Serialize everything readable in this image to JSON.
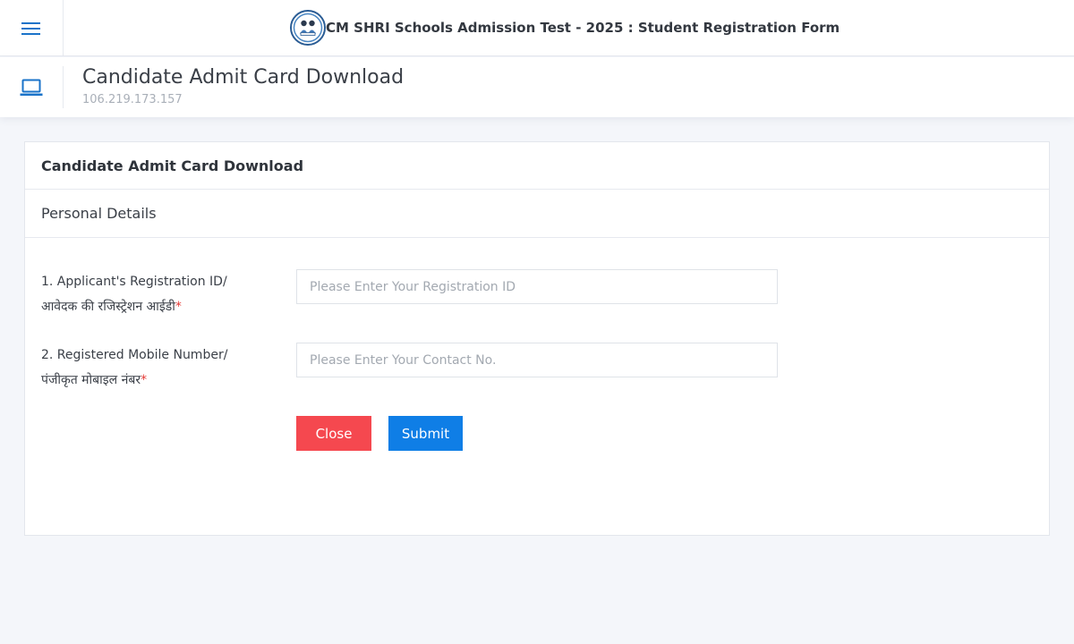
{
  "topbar": {
    "title": "CM SHRI Schools Admission Test - 2025 : Student Registration Form",
    "menu_icon": "hamburger-menu-icon",
    "logo_icon": "school-emblem-icon"
  },
  "page_header": {
    "icon": "laptop-icon",
    "title": "Candidate Admit Card Download",
    "subtitle": "106.219.173.157"
  },
  "card": {
    "title": "Candidate Admit Card Download",
    "section_title": "Personal Details",
    "fields": [
      {
        "label_en": "1. Applicant's Registration ID/",
        "label_hi": "आवेदक की रजिस्ट्रेशन आईडी",
        "required_mark": "*",
        "placeholder": "Please Enter Your Registration ID",
        "value": ""
      },
      {
        "label_en": "2. Registered Mobile Number/",
        "label_hi": "पंजीकृत मोबाइल नंबर",
        "required_mark": "*",
        "placeholder": "Please Enter Your Contact No.",
        "value": ""
      }
    ],
    "close_label": "Close",
    "submit_label": "Submit"
  },
  "colors": {
    "accent": "#0f7ee6",
    "close": "#f5484f",
    "required": "#e53935",
    "background": "#f4f6fa"
  }
}
